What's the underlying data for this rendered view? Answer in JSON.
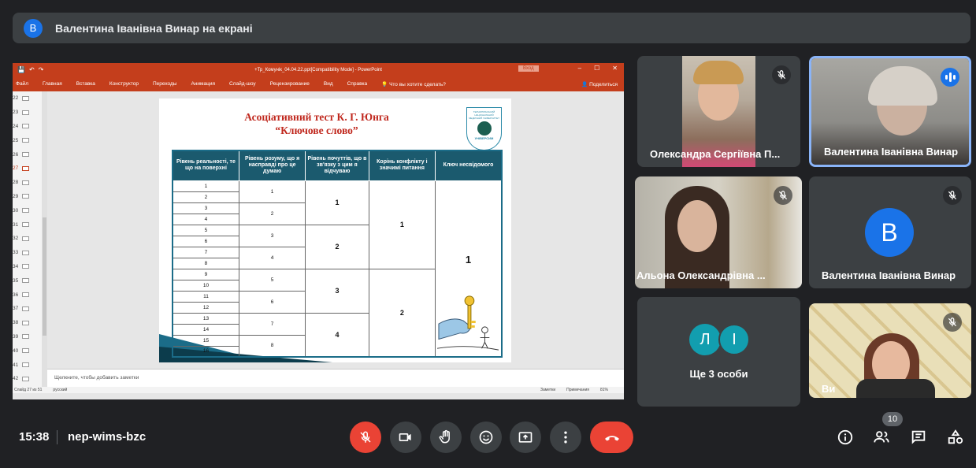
{
  "banner": {
    "avatar_letter": "В",
    "text": "Валентина Іванівна Винар на екрані"
  },
  "powerpoint": {
    "doc_title": "+Тр_Комунік_04.04.22.ppt[Compatibility Mode] - PowerPoint",
    "login": "Вход",
    "menu": [
      "Файл",
      "Главная",
      "Вставка",
      "Конструктор",
      "Переходы",
      "Анимация",
      "Слайд-шоу",
      "Рецензирование",
      "Вид",
      "Справка",
      "Что вы хотите сделать?"
    ],
    "share": "Поделиться",
    "thumb_numbers": [
      "22",
      "23",
      "24",
      "25",
      "26",
      "27",
      "28",
      "29",
      "30",
      "31",
      "32",
      "33",
      "34",
      "35",
      "36",
      "37",
      "38",
      "39",
      "40",
      "41",
      "42"
    ],
    "selected_thumb": "27",
    "notes_placeholder": "Щелкните, чтобы добавить заметки",
    "status_slide": "Слайд 27 из 51",
    "status_lang": "русский",
    "status_notes": "Заметки",
    "status_comments": "Примечания",
    "zoom": "81%"
  },
  "slide": {
    "title_line1": "Асоціативний тест К. Г. Юнга",
    "title_line2": "“Ключове слово”",
    "logo_small": "ТЕРНОПІЛЬСЬКИЙ НАЦІОНАЛЬНИЙ МЕДИЧНИЙ УНІВЕРСИТЕТ",
    "logo_name": "УНІВЕРСИМ",
    "headers": [
      "Рівень реальності, те що на поверхні",
      "Рівень розуму, що я насправді про це думаю",
      "Рівень почуттів, що в зв'язку з цим я відчуваю",
      "Корінь конфлікту і значимі питання",
      "Ключ несвідомого"
    ],
    "col1": [
      "1",
      "2",
      "3",
      "4",
      "5",
      "6",
      "7",
      "8",
      "9",
      "10",
      "11",
      "12",
      "13",
      "14",
      "15",
      "16"
    ],
    "col2": [
      "1",
      "2",
      "3",
      "4",
      "5",
      "6",
      "7",
      "8"
    ],
    "col3": [
      "1",
      "2",
      "3",
      "4"
    ],
    "col4": [
      "1",
      "2"
    ],
    "col5": [
      "1"
    ]
  },
  "participants": [
    {
      "name": "Олександра Сергіївна П...",
      "muted": true
    },
    {
      "name": "Валентина Іванівна Винар",
      "speaking": true
    },
    {
      "name": "Альона Олександрівна ...",
      "muted": true
    },
    {
      "name": "Валентина Іванівна Винар",
      "avatar_letter": "В",
      "muted": true
    },
    {
      "name": "Ще 3 особи",
      "avatar_letters": [
        "Л",
        "І"
      ]
    },
    {
      "name": "Ви",
      "muted": true
    }
  ],
  "bottom": {
    "time": "15:38",
    "meeting_code": "nep-wims-bzc",
    "participant_count": "10"
  },
  "colors": {
    "accent": "#1a73e8",
    "danger": "#ea4335",
    "ppt": "#c43e1c"
  }
}
